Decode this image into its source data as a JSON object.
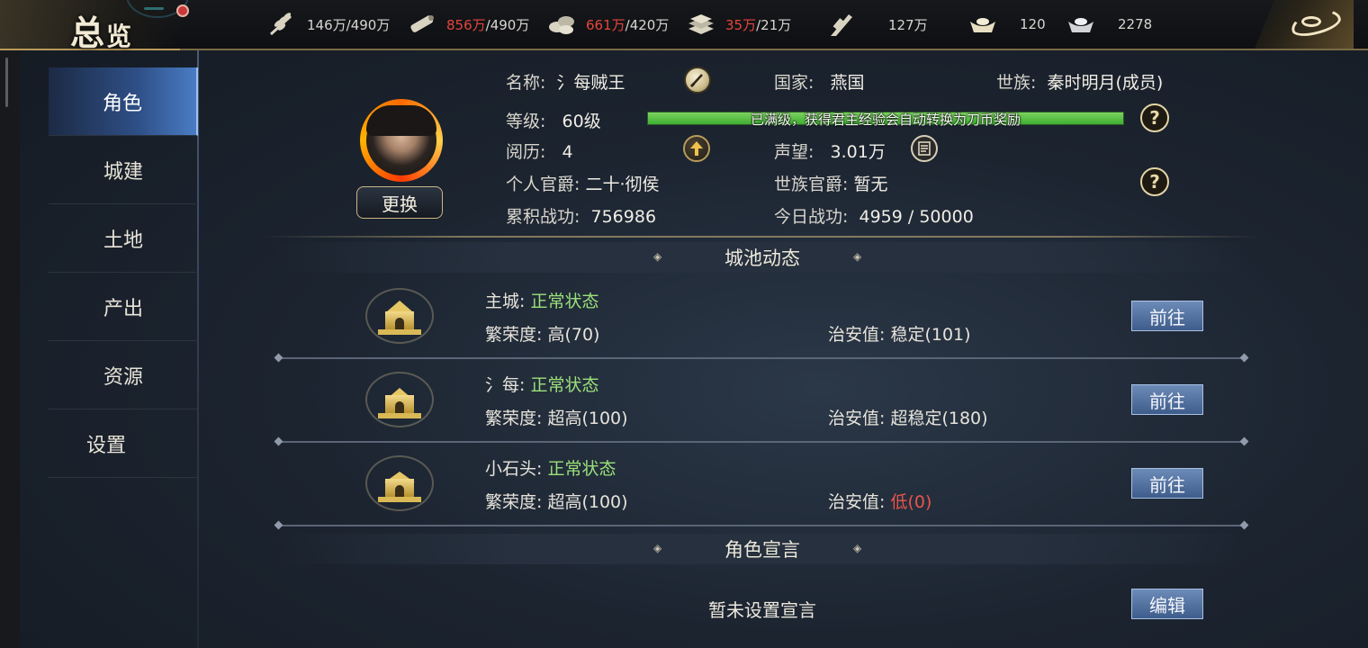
{
  "topbar": {
    "title_main": "总",
    "title_sub": "览",
    "resources": [
      {
        "icon": "grain-icon",
        "current": "146万",
        "max": "/490万",
        "over": false
      },
      {
        "icon": "wood-icon",
        "current": "856万",
        "max": "/490万",
        "over": true
      },
      {
        "icon": "stone-icon",
        "current": "661万",
        "max": "/420万",
        "over": true
      },
      {
        "icon": "iron-icon",
        "current": "35万",
        "max": "/21万",
        "over": true
      },
      {
        "icon": "coin-icon",
        "current": "127万",
        "max": "",
        "over": false
      },
      {
        "icon": "gold-ingot-icon",
        "current": "120",
        "max": "",
        "over": false
      },
      {
        "icon": "silver-ingot-icon",
        "current": "2278",
        "max": "",
        "over": false
      }
    ]
  },
  "sidebar": {
    "items": [
      {
        "label": "角色",
        "active": true
      },
      {
        "label": "城建",
        "active": false
      },
      {
        "label": "土地",
        "active": false
      },
      {
        "label": "产出",
        "active": false
      },
      {
        "label": "资源",
        "active": false
      },
      {
        "label": "设置",
        "active": false
      }
    ]
  },
  "character": {
    "change_label": "更换",
    "name_label": "名称:",
    "name_value": "氵每贼王",
    "country_label": "国家:",
    "country_value": "燕国",
    "clan_label": "世族:",
    "clan_value": "秦时明月(成员)",
    "level_label": "等级:",
    "level_value": "60级",
    "level_bar_text": "已满级，获得君主经验会自动转换为刀币奖励",
    "level_progress": 1.0,
    "experience_label": "阅历:",
    "experience_value": "4",
    "prestige_label": "声望:",
    "prestige_value": "3.01万",
    "rank_label": "个人官爵:",
    "rank_value": "二十·彻侯",
    "clan_rank_label": "世族官爵:",
    "clan_rank_value": "暂无",
    "total_merit_label": "累积战功:",
    "total_merit_value": "756986",
    "today_merit_label": "今日战功:",
    "today_merit_value": "4959 / 50000",
    "help_glyph": "?"
  },
  "cities": {
    "header": "城池动态",
    "go_label": "前往",
    "prosperity_label": "繁荣度:",
    "security_label": "治安值:",
    "rows": [
      {
        "name": "主城:",
        "status": "正常状态",
        "prosperity": "高(70)",
        "security": "稳定(101)",
        "security_low": false
      },
      {
        "name": "氵每:",
        "status": "正常状态",
        "prosperity": "超高(100)",
        "security": "超稳定(180)",
        "security_low": false
      },
      {
        "name": "小石头:",
        "status": "正常状态",
        "prosperity": "超高(100)",
        "security": "低(0)",
        "security_low": true
      }
    ]
  },
  "declaration": {
    "header": "角色宣言",
    "text": "暂未设置宣言",
    "edit_label": "编辑"
  },
  "colors": {
    "accent_blue": "#3e5d8c",
    "status_green": "#9be07a",
    "warning_red": "#e8544a",
    "gold": "#c3ad78"
  }
}
